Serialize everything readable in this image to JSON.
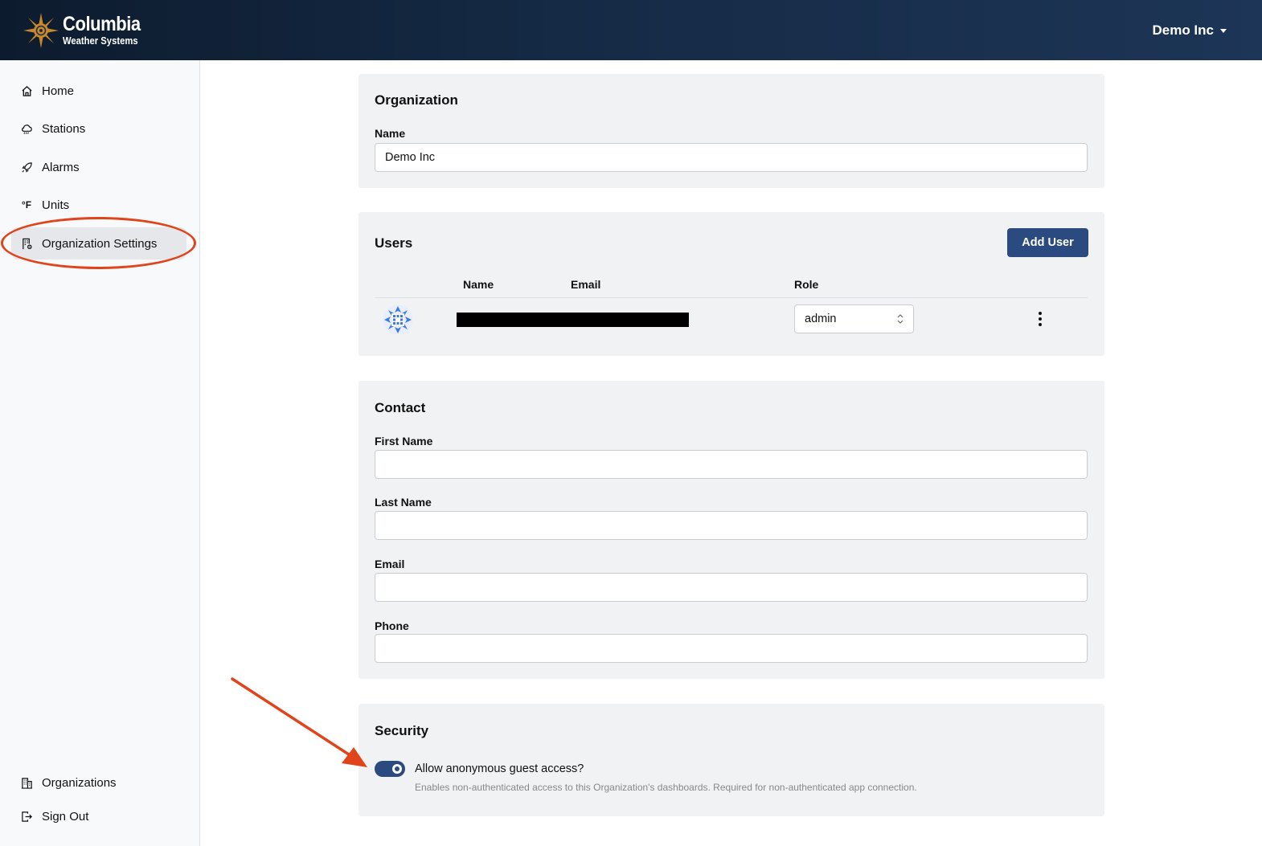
{
  "header": {
    "brand_title": "Columbia",
    "brand_subtitle": "Weather Systems",
    "org_menu_label": "Demo Inc"
  },
  "sidebar": {
    "items": [
      {
        "label": "Home",
        "icon": "home-icon"
      },
      {
        "label": "Stations",
        "icon": "cloud-icon"
      },
      {
        "label": "Alarms",
        "icon": "rocket-icon"
      },
      {
        "label": "Units",
        "icon": "units-icon",
        "icon_text": "°F"
      },
      {
        "label": "Organization Settings",
        "icon": "building-gear-icon",
        "active": true
      }
    ],
    "bottom_items": [
      {
        "label": "Organizations",
        "icon": "buildings-icon"
      },
      {
        "label": "Sign Out",
        "icon": "sign-out-icon"
      }
    ]
  },
  "organization": {
    "title": "Organization",
    "name_label": "Name",
    "name_value": "Demo Inc"
  },
  "users": {
    "title": "Users",
    "add_button": "Add User",
    "columns": {
      "name": "Name",
      "email": "Email",
      "role": "Role"
    },
    "rows": [
      {
        "role": "admin"
      }
    ]
  },
  "contact": {
    "title": "Contact",
    "first_name_label": "First Name",
    "first_name_value": "",
    "last_name_label": "Last Name",
    "last_name_value": "",
    "email_label": "Email",
    "email_value": "",
    "phone_label": "Phone",
    "phone_value": ""
  },
  "security": {
    "title": "Security",
    "guest_access_label": "Allow anonymous guest access?",
    "guest_access_help": "Enables non-authenticated access to this Organization's dashboards. Required for non-authenticated app connection.",
    "guest_access_enabled": true
  },
  "colors": {
    "header_bg": "#152a45",
    "primary": "#2b4a80",
    "annotation": "#e0441a"
  }
}
